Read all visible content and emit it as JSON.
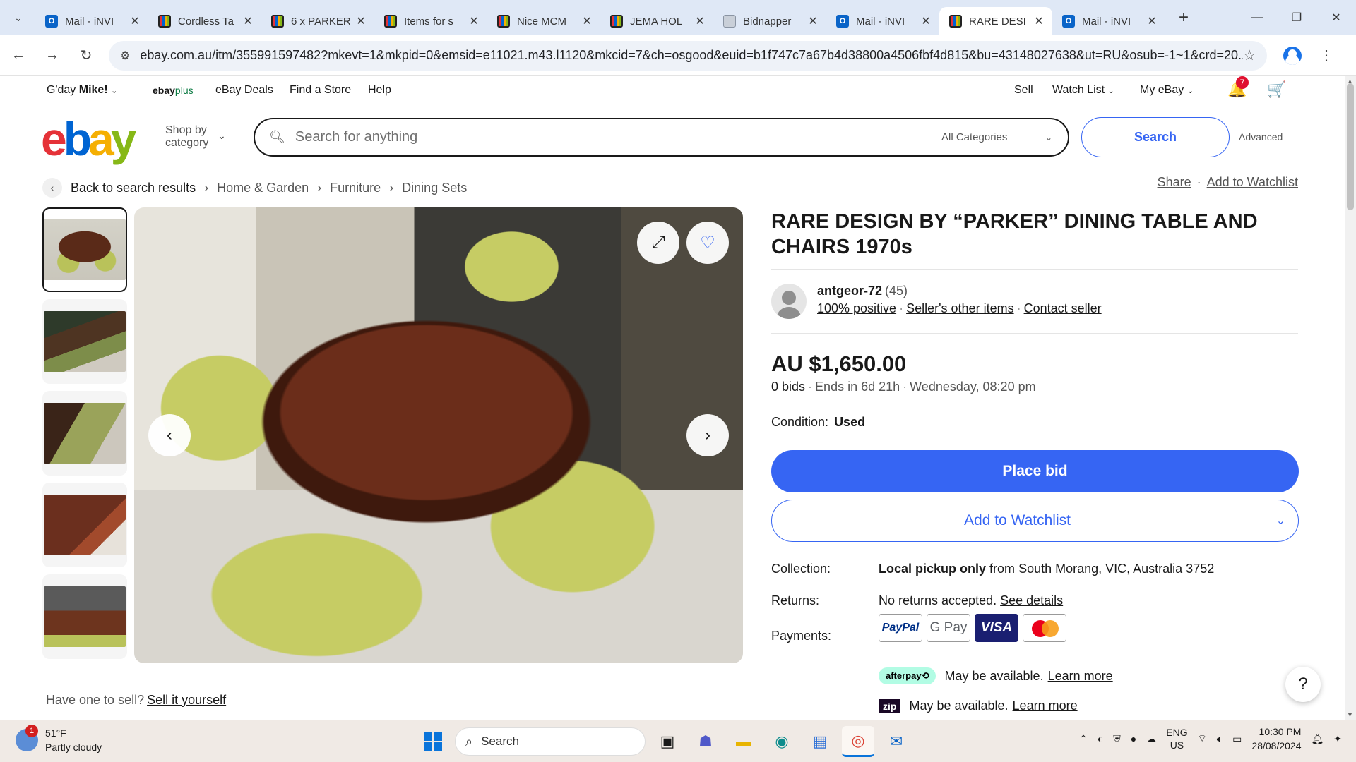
{
  "browser": {
    "tabs": [
      {
        "title": "Mail - iNVI",
        "favicon": "outlook-icon",
        "active": false
      },
      {
        "title": "Cordless Ta",
        "favicon": "ebay-icon",
        "active": false
      },
      {
        "title": "6 x PARKER",
        "favicon": "ebay-icon",
        "active": false
      },
      {
        "title": "Items for s",
        "favicon": "ebay-icon",
        "active": false
      },
      {
        "title": "Nice MCM",
        "favicon": "ebay-icon",
        "active": false
      },
      {
        "title": "JEMA HOL",
        "favicon": "ebay-icon",
        "active": false
      },
      {
        "title": "Bidnapper",
        "favicon": "image-icon",
        "active": false
      },
      {
        "title": "Mail - iNVI",
        "favicon": "outlook-icon",
        "active": false
      },
      {
        "title": "RARE DESI",
        "favicon": "ebay-icon",
        "active": true
      },
      {
        "title": "Mail - iNVI",
        "favicon": "outlook-icon",
        "active": false
      }
    ],
    "url": "ebay.com.au/itm/355991597482?mkevt=1&mkpid=0&emsid=e11021.m43.l1120&mkcid=7&ch=osgood&euid=b1f747c7a67b4d38800a4506fbf4d815&bu=43148027638&ut=RU&osub=-1~1&crd=20..."
  },
  "topnav": {
    "greeting": "G'day",
    "user": "Mike!",
    "ebayplus_a": "ebay",
    "ebayplus_b": "plus",
    "deals": "eBay Deals",
    "store": "Find a Store",
    "help": "Help",
    "sell": "Sell",
    "watchlist": "Watch List",
    "myebay": "My eBay",
    "notif_count": "7"
  },
  "header": {
    "shop_by_1": "Shop by",
    "shop_by_2": "category",
    "search_placeholder": "Search for anything",
    "category": "All Categories",
    "search_button": "Search",
    "advanced": "Advanced"
  },
  "breadcrumb": {
    "back": "Back to search results",
    "items": [
      "Home & Garden",
      "Furniture",
      "Dining Sets"
    ],
    "share": "Share",
    "add_watchlist": "Add to Watchlist"
  },
  "listing": {
    "title": "RARE DESIGN BY “PARKER” DINING TABLE AND CHAIRS 1970s",
    "seller_name": "antgeor-72",
    "seller_count": "(45)",
    "seller_positive": "100% positive",
    "seller_other": "Seller's other items",
    "contact": "Contact seller",
    "price": "AU $1,650.00",
    "bids": "0 bids",
    "ends": "Ends in 6d 21h",
    "end_date": "Wednesday, 08:20 pm",
    "condition_label": "Condition:",
    "condition_value": "Used",
    "place_bid": "Place bid",
    "add_watchlist": "Add to Watchlist",
    "collection_label": "Collection:",
    "collection_bold": "Local pickup only",
    "collection_from": "from",
    "collection_location": "South Morang, VIC, Australia 3752",
    "returns_label": "Returns:",
    "returns_value": "No returns accepted.",
    "returns_link": "See details",
    "payments_label": "Payments:",
    "pay_paypal": "PayPal",
    "pay_gpay": "G Pay",
    "pay_visa": "VISA",
    "afterpay_badge": "afterpay⟲",
    "afterpay_text": "May be available.",
    "afterpay_link": "Learn more",
    "zip_badge": "zip",
    "zip_text": "May be available.",
    "zip_link": "Learn more"
  },
  "footer": {
    "have_one": "Have one to sell?",
    "sell_it": "Sell it yourself"
  },
  "taskbar": {
    "temp": "51°F",
    "weather": "Partly cloudy",
    "weather_badge": "1",
    "search": "Search",
    "lang1": "ENG",
    "lang2": "US",
    "time": "10:30 PM",
    "date": "28/08/2024"
  }
}
